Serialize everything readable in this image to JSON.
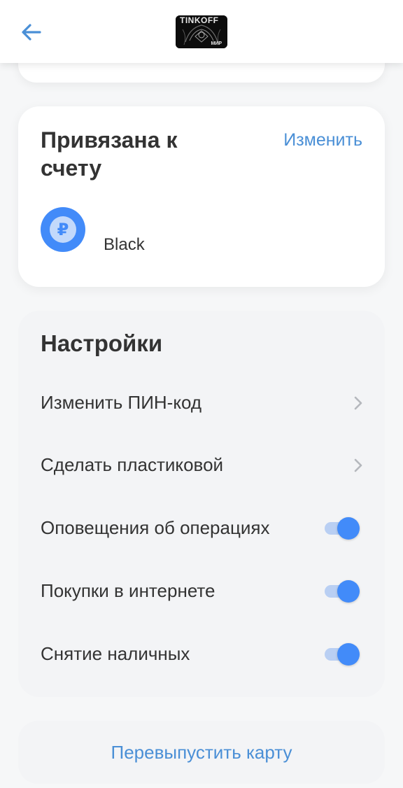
{
  "header": {
    "back_icon": "arrow-left-icon",
    "card_brand_text": "TINKOFF",
    "card_system_text": "МИР"
  },
  "linked_account": {
    "title": "Привязана к счету",
    "change_label": "Изменить",
    "account_icon": "ruble-icon",
    "account_name": "Black",
    "accent_color": "#428bf9"
  },
  "settings": {
    "title": "Настройки",
    "items": [
      {
        "label": "Изменить ПИН-код",
        "control": "chevron"
      },
      {
        "label": "Сделать пластиковой",
        "control": "chevron"
      },
      {
        "label": "Оповещения об операциях",
        "control": "toggle",
        "enabled": true
      },
      {
        "label": "Покупки в интернете",
        "control": "toggle",
        "enabled": true
      },
      {
        "label": "Снятие наличных",
        "control": "toggle",
        "enabled": true
      }
    ]
  },
  "reissue": {
    "label": "Перевыпустить карту"
  },
  "colors": {
    "link": "#4a8fd6",
    "toggle_on": "#428bf9",
    "toggle_track": "#b9cff3",
    "text": "#333333"
  }
}
